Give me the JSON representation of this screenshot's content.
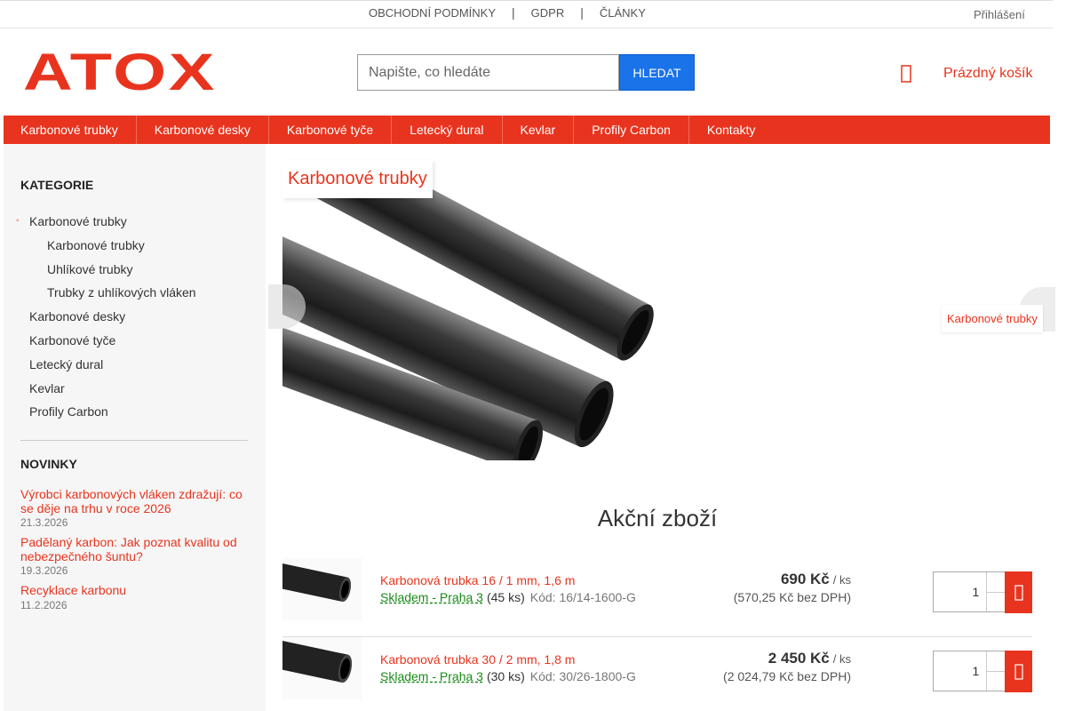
{
  "topbar": {
    "links": [
      "OBCHODNÍ PODMÍNKY",
      "GDPR",
      "ČLÁNKY"
    ],
    "separator": "|",
    "login": "Přihlášení"
  },
  "logo": {
    "text": "ATOX",
    "color": "#e8341e"
  },
  "search": {
    "placeholder": "Napište, co hledáte",
    "button": "HLEDAT"
  },
  "cart": {
    "label": "Prázdný košík",
    "icon": "cart-icon"
  },
  "nav": [
    "Karbonové trubky",
    "Karbonové desky",
    "Karbonové tyče",
    "Letecký dural",
    "Kevlar",
    "Profily Carbon",
    "Kontakty"
  ],
  "sidebar": {
    "categories_title": "KATEGORIE",
    "categories": [
      {
        "label": "Karbonové trubky",
        "sub": false,
        "active": true
      },
      {
        "label": "Karbonové trubky",
        "sub": true
      },
      {
        "label": "Uhlíkové trubky",
        "sub": true
      },
      {
        "label": "Trubky z uhlíkových vláken",
        "sub": true
      },
      {
        "label": "Karbonové desky",
        "sub": false
      },
      {
        "label": "Karbonové tyče",
        "sub": false
      },
      {
        "label": "Letecký dural",
        "sub": false
      },
      {
        "label": "Kevlar",
        "sub": false
      },
      {
        "label": "Profily Carbon",
        "sub": false
      }
    ],
    "news_title": "NOVINKY",
    "news": [
      {
        "title": "Výrobci karbonových vláken zdražují: co se děje na trhu v roce 2026",
        "date": "21.3.2026"
      },
      {
        "title": "Padělaný karbon: Jak poznat kvalitu od nebezpečného šuntu?",
        "date": "19.3.2026"
      },
      {
        "title": "Recyklace karbonu",
        "date": "11.2.2026"
      }
    ]
  },
  "banner": {
    "title": "Karbonové trubky",
    "side_label": "Karbonové trubky"
  },
  "featured_title": "Akční zboží",
  "products": [
    {
      "name": "Karbonová trubka 16 / 1 mm, 1,6 m",
      "stock": "Skladem - Praha 3",
      "qty": "(45 ks)",
      "code": "Kód: 16/14-1600-G",
      "price": "690 Kč",
      "unit": "/ ks",
      "price_novat": "(570,25 Kč bez DPH)",
      "quantity": "1"
    },
    {
      "name": "Karbonová trubka 30 / 2 mm, 1,8 m",
      "stock": "Skladem - Praha 3",
      "qty": "(30 ks)",
      "code": "Kód: 30/26-1800-G",
      "price": "2 450 Kč",
      "unit": "/ ks",
      "price_novat": "(2 024,79 Kč bez DPH)",
      "quantity": "1"
    }
  ]
}
